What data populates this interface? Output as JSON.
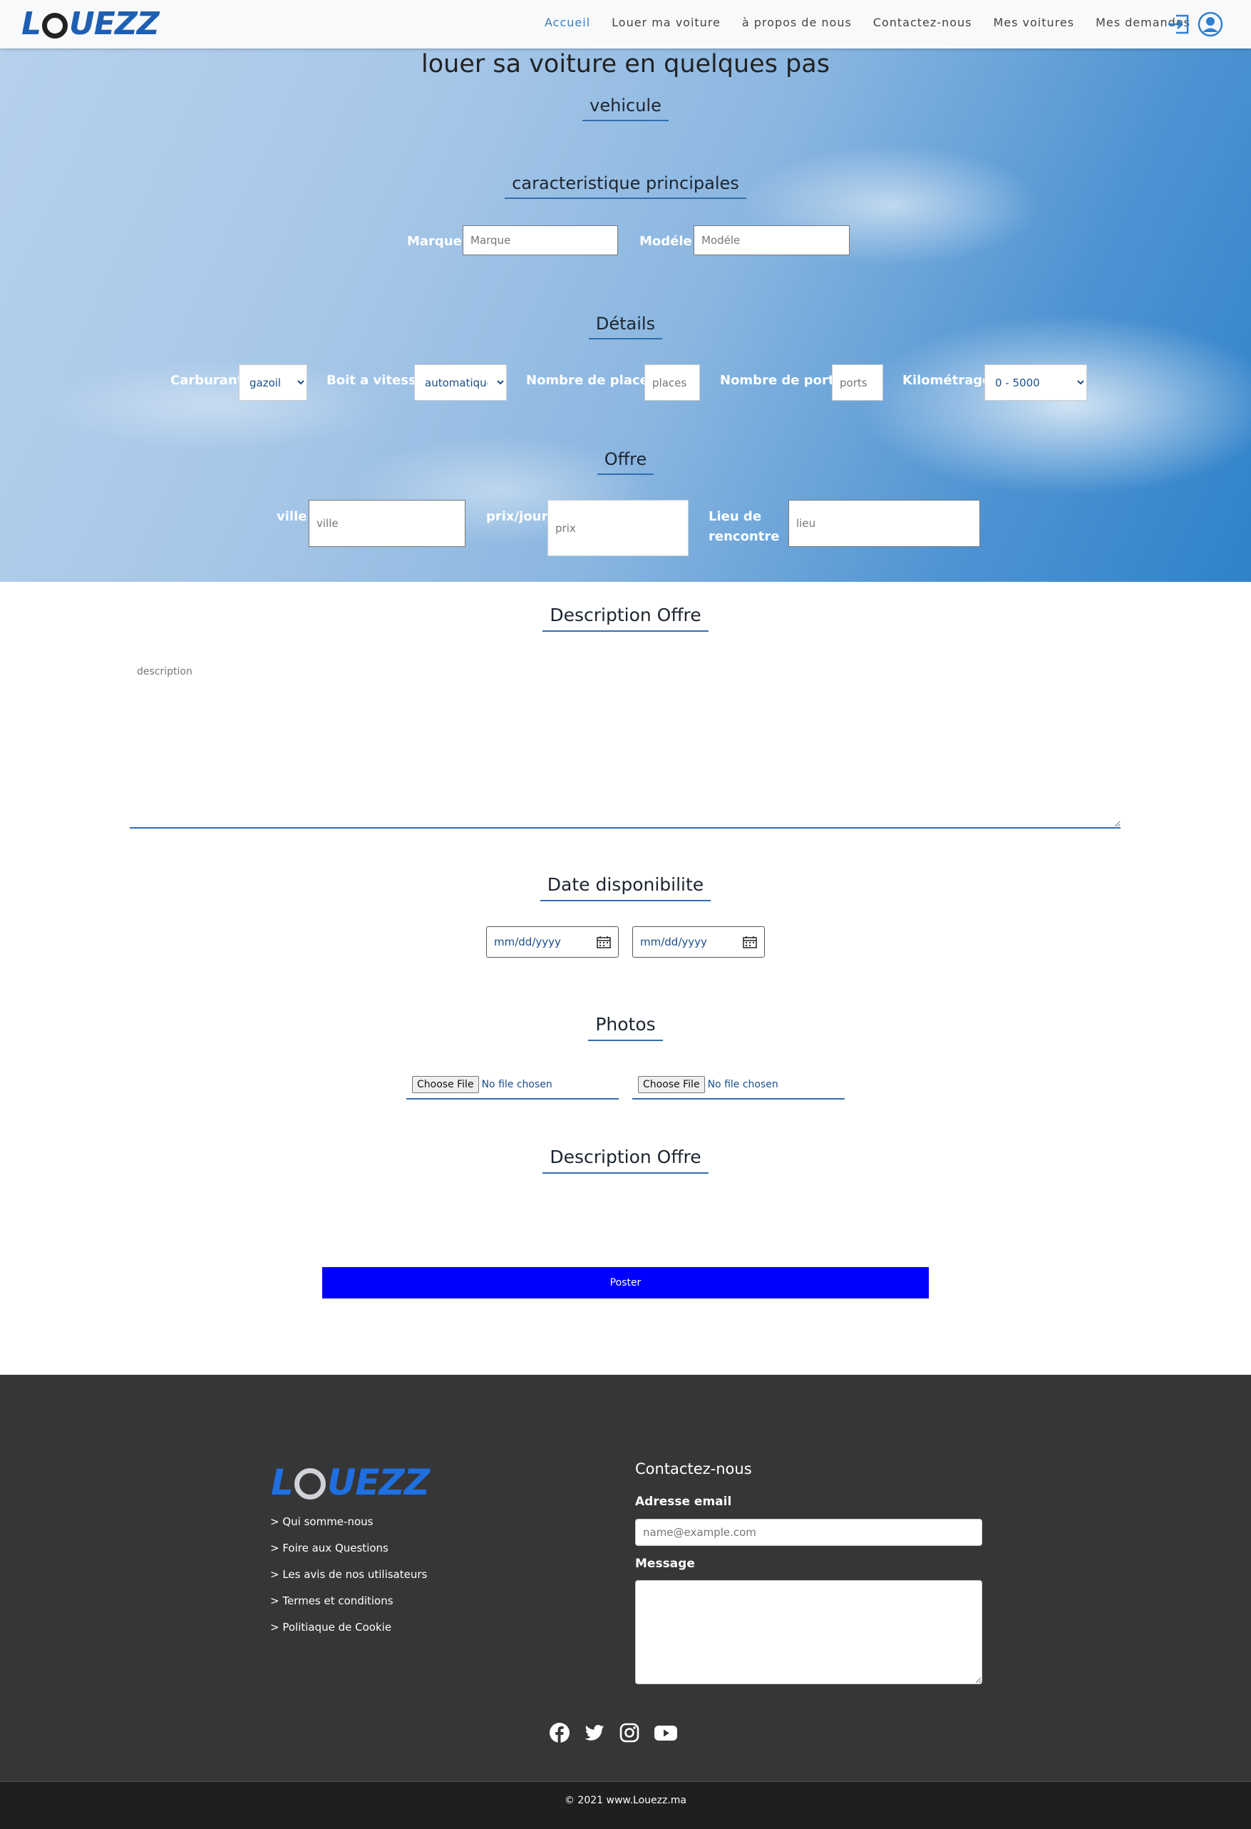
{
  "brand": {
    "logo_text_a": "L",
    "logo_text_b": "UEZZ"
  },
  "nav": {
    "links": [
      "Accueil",
      "Louer ma voiture",
      "à propos de nous",
      "Contactez-nous",
      "Mes voitures",
      "Mes demandes"
    ],
    "active": "Accueil",
    "icons": [
      "login-icon",
      "user-account-icon"
    ],
    "accent": "#3a7cc2"
  },
  "hero": {
    "title": "louer sa voiture en quelques pas",
    "vehicle_heading": "vehicule",
    "main_heading": "caracteristique principales",
    "marque_label": "Marque",
    "marque_placeholder": "Marque",
    "modele_label": "Modéle",
    "modele_placeholder": "Modéle",
    "details_heading": "Détails",
    "carburant_label": "Carburant",
    "carburant_value": "gazoil",
    "boite_label": "Boit a vitesse",
    "boite_value": "automatique",
    "places_label": "Nombre de places",
    "places_placeholder": "places",
    "ports_label": "Nombre de ports",
    "ports_placeholder": "ports",
    "km_label": "Kilométrage",
    "km_value": "0 - 5000",
    "offre_heading": "Offre",
    "ville_label": "ville",
    "ville_placeholder": "ville",
    "prix_label": "prix/jour",
    "prix_placeholder": "prix",
    "lieu_label_1": "Lieu de",
    "lieu_label_2": "rencontre",
    "lieu_placeholder": "lieu"
  },
  "form": {
    "description_heading": "Description Offre",
    "description_placeholder": "description",
    "date_heading": "Date disponibilite",
    "date_from_placeholder": "mm/dd/yyyy",
    "date_to_placeholder": "mm/dd/yyyy",
    "photos_heading": "Photos",
    "file_button": "Choose File",
    "file_status": "No file chosen",
    "description2_heading": "Description Offre",
    "submit_label": "Poster",
    "submit_color": "#0000ff"
  },
  "footer": {
    "links": [
      "> Qui somme-nous",
      "> Foire aux Questions",
      "> Les avis de nos utilisateurs",
      "> Termes et conditions",
      "> Politiaque de Cookie"
    ],
    "contact_title": "Contactez-nous",
    "email_label": "Adresse email",
    "email_placeholder": "name@example.com",
    "message_label": "Message",
    "social_icons": [
      "facebook-icon",
      "twitter-icon",
      "instagram-icon",
      "youtube-icon"
    ],
    "copyright": "© 2021 www.Louezz.ma"
  }
}
